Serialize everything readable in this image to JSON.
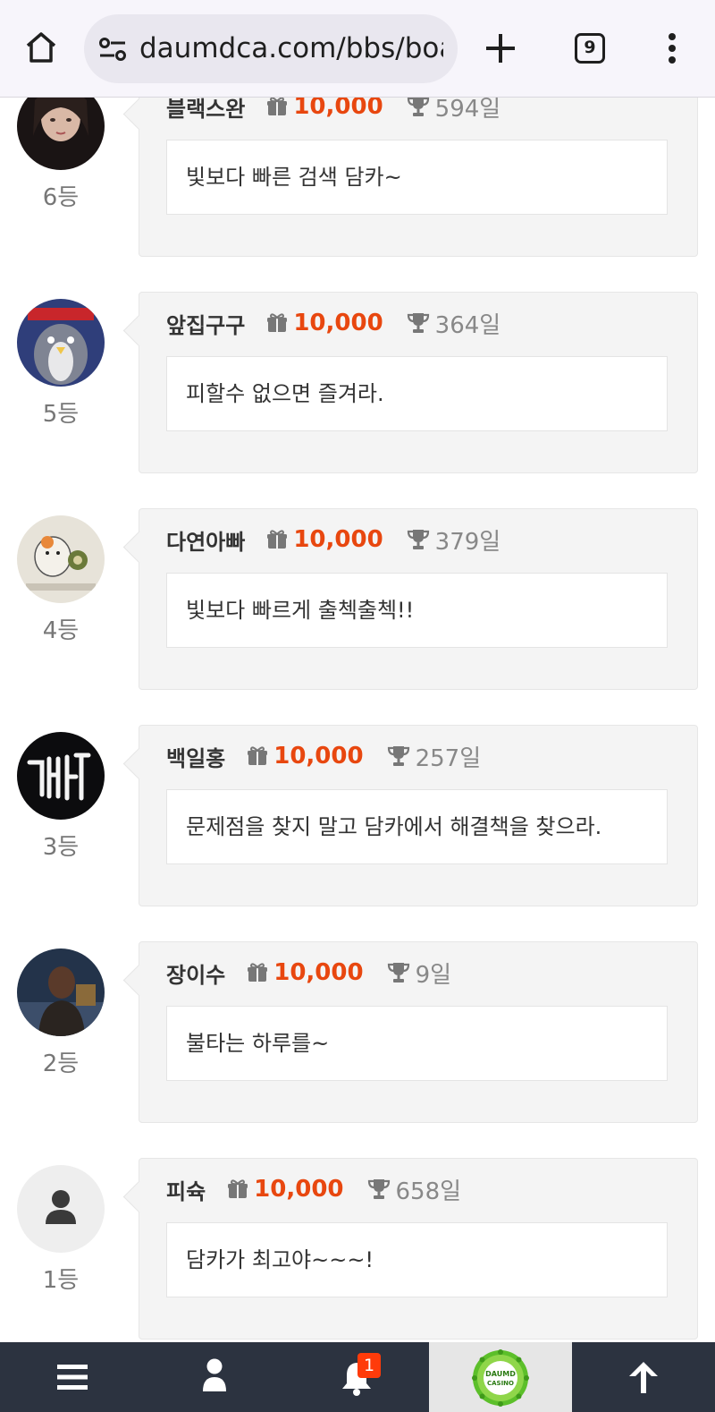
{
  "browser": {
    "url": "daumdca.com/bbs/board",
    "tab_count": "9"
  },
  "ranking": [
    {
      "nickname": "블랙스완",
      "points": "10,000",
      "days": "594일",
      "rank": "6등",
      "message": "빛보다 빠른 검색 담카~",
      "avatar": "photo-woman"
    },
    {
      "nickname": "앞집구구",
      "points": "10,000",
      "days": "364일",
      "rank": "5등",
      "message": "피할수 없으면 즐겨라.",
      "avatar": "cartoon-penguin"
    },
    {
      "nickname": "다연아빠",
      "points": "10,000",
      "days": "379일",
      "rank": "4등",
      "message": "빛보다 빠르게 출첵출첵!!",
      "avatar": "cartoon-hamster"
    },
    {
      "nickname": "백일홍",
      "points": "10,000",
      "days": "257일",
      "rank": "3등",
      "message": "문제점을 찾지 말고 담카에서 해결책을 찾으라.",
      "avatar": "neon-sign"
    },
    {
      "nickname": "장이수",
      "points": "10,000",
      "days": "9일",
      "rank": "2등",
      "message": "불타는 하루를~",
      "avatar": "photo-man"
    },
    {
      "nickname": "피슉",
      "points": "10,000",
      "days": "658일",
      "rank": "1등",
      "message": "담카가 최고야~~~!",
      "avatar": "default-user"
    }
  ],
  "bottom_nav": {
    "notification_count": "1",
    "logo_text_top": "DAUMD",
    "logo_text_bottom": "CASINO"
  },
  "colors": {
    "points": "#e8470f",
    "nav_background": "#2c3340",
    "card_background": "#f4f4f4"
  }
}
